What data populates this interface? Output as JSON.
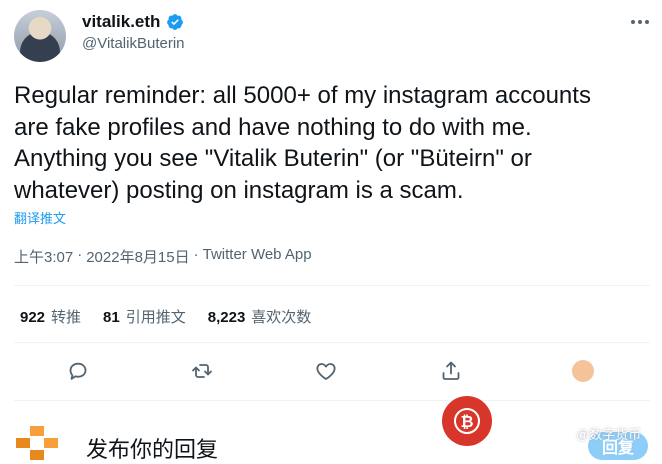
{
  "author": {
    "display_name": "vitalik.eth",
    "handle": "@VitalikButerin",
    "verified": true
  },
  "tweet": {
    "text": "Regular reminder: all 5000+ of my instagram accounts\nare fake profiles and have nothing to do with me.\nAnything you see \"Vitalik Buterin\" (or \"Büteirn\" or\nwhatever) posting on instagram is a scam.",
    "translate_label": "翻译推文"
  },
  "meta": {
    "time": "上午3:07",
    "sep1": "·",
    "date": "2022年8月15日",
    "sep2": "·",
    "source": "Twitter Web App"
  },
  "stats": [
    {
      "value": "922",
      "label": "转推"
    },
    {
      "value": "81",
      "label": "引用推文"
    },
    {
      "value": "8,223",
      "label": "喜欢次数"
    }
  ],
  "reply": {
    "placeholder": "发布你的回复",
    "button_label": "回复"
  },
  "watermark": {
    "text": "@数字货币"
  },
  "colors": {
    "accent": "#1d9bf0",
    "reply_button": "#8ecdf8",
    "watermark_red": "#d9362b"
  }
}
